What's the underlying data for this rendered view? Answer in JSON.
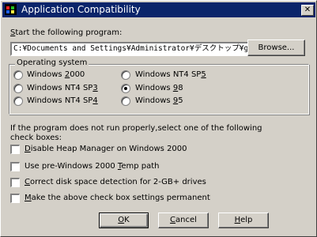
{
  "window": {
    "title": "Application Compatibility",
    "close_glyph": "✕"
  },
  "program": {
    "label_key": "S",
    "label_rest": "tart the following program:",
    "value": "C:¥Documents and Settings¥Administrator¥デスクトップ¥getv",
    "browse_label": "Browse..."
  },
  "os_group": {
    "title": "Operating system",
    "options": [
      {
        "pre": "Windows ",
        "key": "2",
        "post": "000",
        "selected": false
      },
      {
        "pre": "Windows NT4 SP",
        "key": "3",
        "post": "",
        "selected": false
      },
      {
        "pre": "Windows NT4 SP",
        "key": "4",
        "post": "",
        "selected": false
      },
      {
        "pre": "Windows NT4 SP",
        "key": "5",
        "post": "",
        "selected": false
      },
      {
        "pre": "Windows ",
        "key": "9",
        "post": "8",
        "selected": true
      },
      {
        "pre": "Windows ",
        "key": "9",
        "post": "5",
        "selected": false
      }
    ]
  },
  "instructions": {
    "line1": "If the program does not run properly,select one of the following",
    "line2": "check boxes:"
  },
  "checkboxes": [
    {
      "pre": "",
      "key": "D",
      "post": "isable Heap Manager on Windows 2000",
      "checked": false
    },
    {
      "pre": "Use pre-Windows 2000 ",
      "key": "T",
      "post": "emp path",
      "checked": false
    },
    {
      "pre": "",
      "key": "C",
      "post": "orrect disk space detection for 2-GB+ drives",
      "checked": false
    },
    {
      "pre": "",
      "key": "M",
      "post": "ake the above check box settings permanent",
      "checked": false
    }
  ],
  "buttons": {
    "ok": {
      "key": "O",
      "rest": "K"
    },
    "cancel": {
      "key": "C",
      "rest": "ancel"
    },
    "help": {
      "key": "H",
      "rest": "elp"
    }
  }
}
